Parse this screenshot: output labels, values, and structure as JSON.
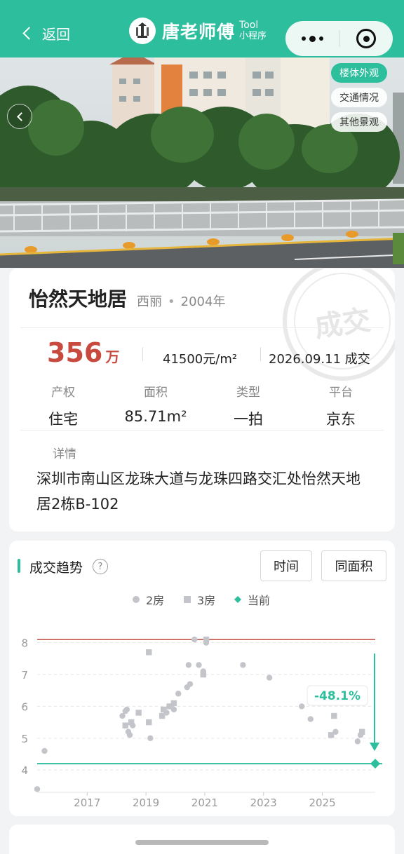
{
  "nav": {
    "back_label": "返回",
    "app_title": "唐老师傅",
    "app_tool": "Tool",
    "app_type": "小程序"
  },
  "photo": {
    "tabs": [
      "楼体外观",
      "交通情况",
      "其他景观"
    ],
    "active_tab": 0
  },
  "listing": {
    "name": "怡然天地居",
    "district": "西丽",
    "separator": "•",
    "year": "2004年",
    "price_value": "356",
    "price_unit": "万",
    "unit_price": "41500元/m²",
    "deal_date": "2026.09.11 成交",
    "stamp_text": "成交",
    "stats": [
      {
        "label": "产权",
        "value": "住宅"
      },
      {
        "label": "面积",
        "value": "85.71m²"
      },
      {
        "label": "类型",
        "value": "一拍"
      },
      {
        "label": "平台",
        "value": "京东"
      }
    ],
    "detail_label": "详情",
    "address": "深圳市南山区龙珠大道与龙珠四路交汇处怡然天地居2栋B-102"
  },
  "trend": {
    "title": "成交趋势",
    "help": "?",
    "btn_time": "时间",
    "btn_area": "同面积",
    "legend": [
      "2房",
      "3房",
      "当前"
    ],
    "change_label": "-48.1%"
  },
  "colors": {
    "accent": "#2dbf9d",
    "price_red": "#c8493e",
    "max_line": "#c0463c",
    "point_grey": "#c3c5ca"
  },
  "chart_data": {
    "type": "scatter",
    "title": "成交趋势",
    "xlabel": "",
    "ylabel": "",
    "xlim": [
      2015.3,
      2026.8
    ],
    "ylim": [
      3.3,
      8.3
    ],
    "x_ticks": [
      2017,
      2019,
      2021,
      2023,
      2025
    ],
    "y_ticks": [
      4,
      5,
      6,
      7,
      8
    ],
    "grid": true,
    "legend_position": "top-center",
    "reference_lines": {
      "max": 8.1,
      "current": 4.2
    },
    "series": [
      {
        "name": "2房",
        "marker": "circle",
        "points": [
          [
            2015.3,
            3.4
          ],
          [
            2015.55,
            4.6
          ],
          [
            2018.2,
            5.7
          ],
          [
            2018.3,
            5.85
          ],
          [
            2018.35,
            5.9
          ],
          [
            2018.4,
            5.2
          ],
          [
            2018.45,
            5.1
          ],
          [
            2018.55,
            5.4
          ],
          [
            2019.15,
            5.0
          ],
          [
            2019.7,
            5.8
          ],
          [
            2019.85,
            6.0
          ],
          [
            2019.95,
            5.9
          ],
          [
            2020.1,
            6.4
          ],
          [
            2020.4,
            6.6
          ],
          [
            2020.5,
            6.7
          ],
          [
            2020.45,
            7.3
          ],
          [
            2020.65,
            8.1
          ],
          [
            2020.8,
            7.3
          ],
          [
            2020.95,
            7.1
          ],
          [
            2021.05,
            8.0
          ],
          [
            2022.3,
            7.3
          ],
          [
            2023.2,
            6.9
          ],
          [
            2024.3,
            6.0
          ],
          [
            2024.6,
            5.6
          ],
          [
            2025.45,
            5.2
          ],
          [
            2026.2,
            4.9
          ],
          [
            2026.3,
            5.1
          ]
        ]
      },
      {
        "name": "3房",
        "marker": "square",
        "points": [
          [
            2018.3,
            5.4
          ],
          [
            2018.5,
            5.5
          ],
          [
            2018.75,
            5.8
          ],
          [
            2019.1,
            7.7
          ],
          [
            2019.1,
            5.5
          ],
          [
            2019.55,
            5.7
          ],
          [
            2019.6,
            5.9
          ],
          [
            2019.8,
            6.0
          ],
          [
            2019.95,
            6.1
          ],
          [
            2020.95,
            7.0
          ],
          [
            2021.05,
            8.1
          ],
          [
            2024.7,
            6.3
          ],
          [
            2025.3,
            5.1
          ],
          [
            2025.4,
            5.7
          ],
          [
            2026.35,
            5.2
          ]
        ]
      },
      {
        "name": "当前",
        "marker": "diamond",
        "points": [
          [
            2026.8,
            4.2
          ]
        ]
      }
    ]
  }
}
